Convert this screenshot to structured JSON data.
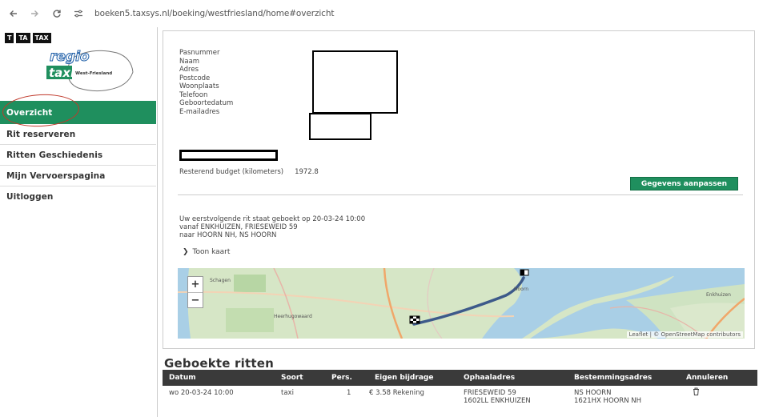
{
  "browser": {
    "url": "boeken5.taxsys.nl/boeking/westfriesland/home#overzicht",
    "icons": [
      "back-icon",
      "forward-icon",
      "reload-icon",
      "site-info-icon"
    ]
  },
  "logo": {
    "boxes": [
      "T",
      "TA",
      "TAX"
    ],
    "regio": "regio",
    "taxi": "taxi",
    "region": "West-Friesland"
  },
  "sidebar": {
    "items": [
      {
        "label": "Overzicht",
        "active": true
      },
      {
        "label": "Rit reserveren"
      },
      {
        "label": "Ritten Geschiedenis"
      },
      {
        "label": "Mijn Vervoerspagina"
      },
      {
        "label": "Uitloggen"
      }
    ]
  },
  "profile": {
    "fields": [
      "Pasnummer",
      "Naam",
      "Adres",
      "Postcode",
      "Woonplaats",
      "Telefoon",
      "Geboortedatum",
      "E-mailadres"
    ],
    "budget_label": "Resterend budget (kilometers)",
    "budget_value": "1972.8",
    "edit_button": "Gegevens aanpassen"
  },
  "next_ride": {
    "line1": "Uw eerstvolgende rit staat geboekt op 20-03-24 10:00",
    "line2": "vanaf ENKHUIZEN, FRIESEWEID 59",
    "line3": "naar HOORN NH, NS HOORN",
    "show_map": "Toon kaart"
  },
  "map": {
    "zoom_in": "+",
    "zoom_out": "−",
    "attribution": "Leaflet | © OpenStreetMap contributors",
    "places": [
      "Schagen",
      "Heerhugowaard",
      "Hoorn",
      "Enkhuizen"
    ]
  },
  "booked": {
    "title": "Geboekte ritten",
    "columns": [
      "Datum",
      "Soort",
      "Pers.",
      "Eigen bijdrage",
      "Ophaaladres",
      "Bestemmingsadres",
      "Annuleren"
    ],
    "rows": [
      {
        "datum": "wo 20-03-24 10:00",
        "soort": "taxi",
        "pers": "1",
        "bijdrage": "€ 3.58 Rekening",
        "ophaal1": "FRIESEWEID 59",
        "ophaal2": "1602LL ENKHUIZEN",
        "bestemming1": "NS HOORN",
        "bestemming2": "1621HX HOORN NH",
        "cancel_icon": "trash-icon"
      }
    ]
  },
  "colors": {
    "accent": "#1f8f5e",
    "table_header": "#3a3a3a",
    "annotation": "#c0392b"
  }
}
